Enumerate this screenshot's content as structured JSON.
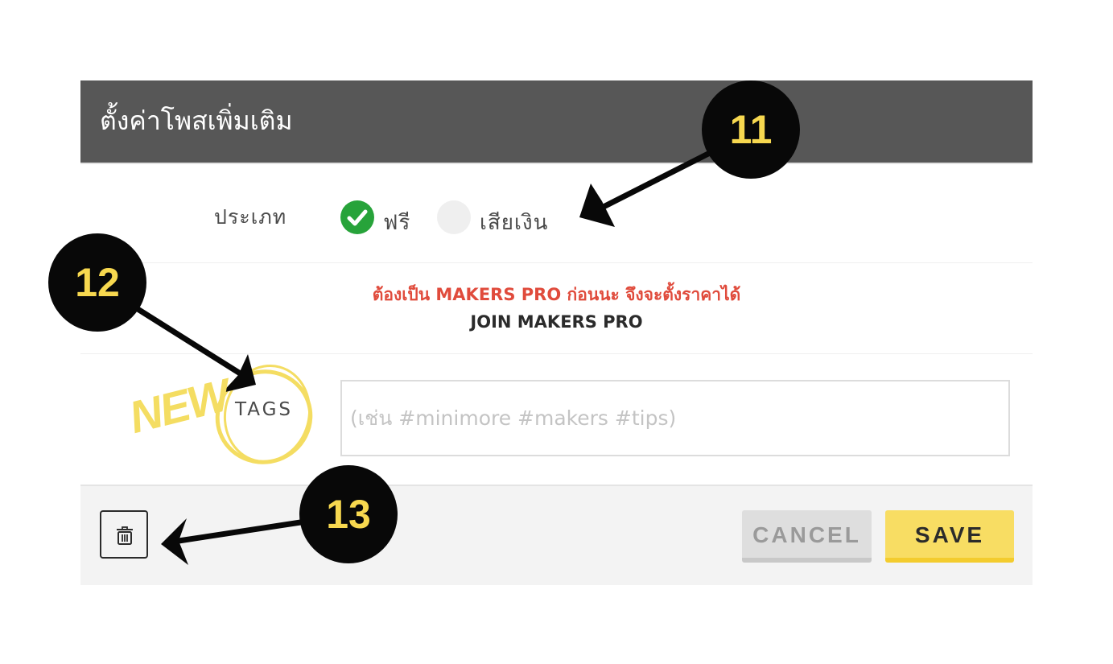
{
  "header": {
    "title": "ตั้งค่าโพสเพิ่มเติม"
  },
  "type_row": {
    "label": "ประเภท",
    "options": [
      {
        "label": "ฟรี",
        "selected": true
      },
      {
        "label": "เสียเงิน",
        "selected": false
      }
    ]
  },
  "pro_notice": {
    "warning": "ต้องเป็น MAKERS PRO ก่อนนะ จึงจะตั้งราคาได้",
    "join_label": "JOIN MAKERS PRO"
  },
  "tags": {
    "label": "TAGS",
    "placeholder": "(เช่น #minimore #makers #tips)",
    "value": ""
  },
  "footer": {
    "delete_icon": "trash-icon",
    "cancel_label": "CANCEL",
    "save_label": "SAVE"
  },
  "annotations": {
    "badges": [
      "11",
      "12",
      "13"
    ],
    "new_label": "NEW"
  },
  "colors": {
    "header_bg": "#575757",
    "check_green": "#27a33a",
    "warning_red": "#e04b3c",
    "save_yellow": "#f8dd63",
    "badge_black": "#080808",
    "badge_text": "#f7d84f"
  }
}
